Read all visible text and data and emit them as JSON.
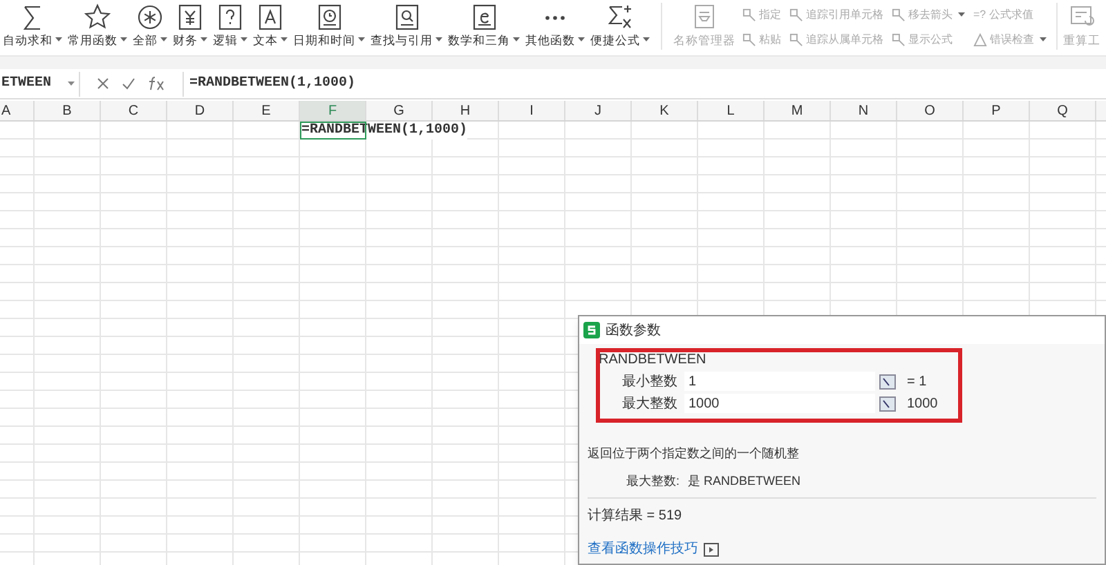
{
  "ribbon": {
    "functions": [
      {
        "label": "自动求和",
        "dropdown": true
      },
      {
        "label": "常用函数",
        "dropdown": true
      },
      {
        "label": "全部",
        "dropdown": true
      },
      {
        "label": "财务",
        "dropdown": true
      },
      {
        "label": "逻辑",
        "dropdown": true
      },
      {
        "label": "文本",
        "dropdown": true
      },
      {
        "label": "日期和时间",
        "dropdown": true
      },
      {
        "label": "查找与引用",
        "dropdown": true
      },
      {
        "label": "数学和三角",
        "dropdown": true
      },
      {
        "label": "其他函数",
        "dropdown": true
      },
      {
        "label": "便捷公式",
        "dropdown": true
      }
    ],
    "name_manager": {
      "label": "名称管理器",
      "disabled": true
    },
    "small_tools": [
      [
        {
          "label": "指定",
          "dropdown": false,
          "disabled": true
        },
        {
          "label": "粘贴",
          "dropdown": false,
          "disabled": true
        }
      ],
      [
        {
          "label": "追踪引用单元格",
          "dropdown": false,
          "disabled": true
        },
        {
          "label": "追踪从属单元格",
          "dropdown": false,
          "disabled": true
        }
      ],
      [
        {
          "label": "移去箭头",
          "dropdown": true,
          "disabled": true
        },
        {
          "label": "显示公式",
          "dropdown": false,
          "disabled": true
        }
      ],
      [
        {
          "label": "=? 公式求值",
          "dropdown": false,
          "disabled": true
        },
        {
          "label": "错误检查",
          "dropdown": true,
          "disabled": true
        }
      ]
    ],
    "recalc": {
      "label": "重算工",
      "disabled": true
    }
  },
  "formula_bar": {
    "name_box": "ETWEEN",
    "formula": "=RANDBETWEEN(1,1000)"
  },
  "columns": [
    {
      "label": "A",
      "selected": false
    },
    {
      "label": "B",
      "selected": false
    },
    {
      "label": "C",
      "selected": false
    },
    {
      "label": "D",
      "selected": false
    },
    {
      "label": "E",
      "selected": false
    },
    {
      "label": "F",
      "selected": true
    },
    {
      "label": "G",
      "selected": false
    },
    {
      "label": "H",
      "selected": false
    },
    {
      "label": "I",
      "selected": false
    },
    {
      "label": "J",
      "selected": false
    },
    {
      "label": "K",
      "selected": false
    },
    {
      "label": "L",
      "selected": false
    },
    {
      "label": "M",
      "selected": false
    },
    {
      "label": "N",
      "selected": false
    },
    {
      "label": "O",
      "selected": false
    },
    {
      "label": "P",
      "selected": false
    },
    {
      "label": "Q",
      "selected": false
    }
  ],
  "active_cell": {
    "value": "=RANDBETWEEN(1,1000)"
  },
  "dialog": {
    "title": "函数参数",
    "function_name": "RANDBETWEEN",
    "args": [
      {
        "label": "最小整数",
        "value": "1",
        "result": "= 1"
      },
      {
        "label": "最大整数",
        "value": "1000",
        "result": "1000"
      }
    ],
    "description": "返回位于两个指定数之间的一个随机整",
    "arg_help_label": "最大整数:",
    "arg_help": "是 RANDBETWEEN",
    "result": "计算结果 = 519",
    "link": "查看函数操作技巧"
  }
}
